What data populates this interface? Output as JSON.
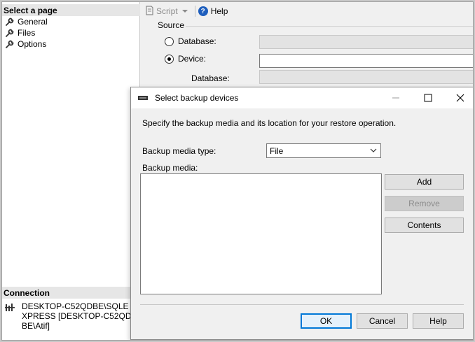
{
  "left_pane": {
    "select_page_header": "Select a page",
    "pages": [
      {
        "label": "General",
        "icon": "wrench-icon"
      },
      {
        "label": "Files",
        "icon": "wrench-icon"
      },
      {
        "label": "Options",
        "icon": "wrench-icon"
      }
    ],
    "connection_header": "Connection",
    "connection_text": "DESKTOP-C52QDBE\\SQLEXPRESS [DESKTOP-C52QDBE\\Atif]",
    "connection_icon": "server-connection-icon"
  },
  "toolbar": {
    "script_label": "Script",
    "help_label": "Help"
  },
  "source": {
    "heading": "Source",
    "database_radio_label": "Database:",
    "device_radio_label": "Device:",
    "device_selected": true,
    "database_sub_label": "Database:"
  },
  "dialog": {
    "title": "Select backup devices",
    "description": "Specify the backup media and its location for your restore operation.",
    "media_type_label": "Backup media type:",
    "media_type_value": "File",
    "backup_media_label": "Backup media:",
    "buttons": {
      "add": "Add",
      "remove": "Remove",
      "contents": "Contents",
      "ok": "OK",
      "cancel": "Cancel",
      "help": "Help"
    }
  },
  "colors": {
    "accent": "#0078d7",
    "help_icon": "#1e5ebd",
    "pane_header_bg": "#e6e6e6"
  }
}
